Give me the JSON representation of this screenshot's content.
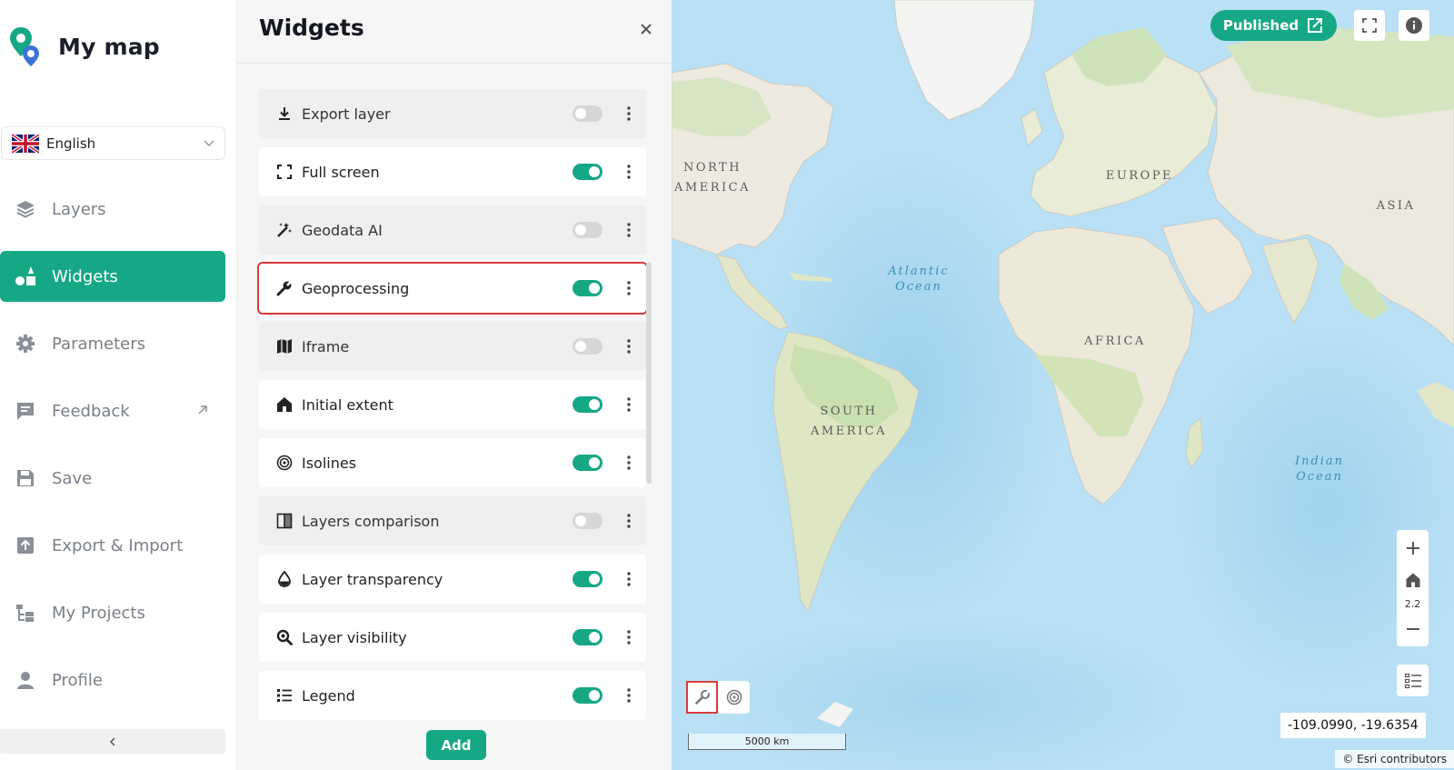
{
  "app": {
    "title": "My map",
    "language": "English"
  },
  "sidebar": {
    "items": [
      {
        "label": "Layers",
        "icon": "layers-icon",
        "active": false
      },
      {
        "label": "Widgets",
        "icon": "widgets-icon",
        "active": true
      },
      {
        "label": "Parameters",
        "icon": "gear-icon",
        "active": false
      },
      {
        "label": "Feedback",
        "icon": "feedback-icon",
        "active": false
      },
      {
        "label": "Save",
        "icon": "save-icon",
        "active": false
      },
      {
        "label": "Export & Import",
        "icon": "export-icon",
        "active": false
      },
      {
        "label": "My Projects",
        "icon": "projects-icon",
        "active": false
      },
      {
        "label": "Profile",
        "icon": "profile-icon",
        "active": false
      }
    ]
  },
  "panel": {
    "title": "Widgets",
    "add_label": "Add",
    "widgets": [
      {
        "label": "Export layer",
        "icon": "download-icon",
        "enabled": false
      },
      {
        "label": "Full screen",
        "icon": "fullscreen-icon",
        "enabled": true
      },
      {
        "label": "Geodata AI",
        "icon": "magic-wand-icon",
        "enabled": false
      },
      {
        "label": "Geoprocessing",
        "icon": "wrench-icon",
        "enabled": true,
        "selected": true
      },
      {
        "label": "Iframe",
        "icon": "map-icon",
        "enabled": false
      },
      {
        "label": "Initial extent",
        "icon": "home-icon",
        "enabled": true
      },
      {
        "label": "Isolines",
        "icon": "target-icon",
        "enabled": true
      },
      {
        "label": "Layers comparison",
        "icon": "compare-icon",
        "enabled": false
      },
      {
        "label": "Layer transparency",
        "icon": "droplet-icon",
        "enabled": true
      },
      {
        "label": "Layer visibility",
        "icon": "search-eye-icon",
        "enabled": true
      },
      {
        "label": "Legend",
        "icon": "legend-icon",
        "enabled": true
      }
    ]
  },
  "map": {
    "published_label": "Published",
    "zoom_level": "2.2",
    "scale_label": "5000 km",
    "coordinates": "-109.0990, -19.6354",
    "attribution": "© Esri contributors",
    "labels": {
      "north_america_1": "NORTH",
      "north_america_2": "AMERICA",
      "south_america_1": "SOUTH",
      "south_america_2": "AMERICA",
      "europe": "EUROPE",
      "asia": "ASIA",
      "africa": "AFRICA",
      "atlantic_1": "Atlantic",
      "atlantic_2": "Ocean",
      "indian_1": "Indian",
      "indian_2": "Ocean"
    }
  },
  "colors": {
    "accent": "#16a886",
    "selection": "#d93a3a",
    "ocean": "#b9e0f4",
    "land": "#eeeadf",
    "vegetation": "#cfe3bb"
  }
}
